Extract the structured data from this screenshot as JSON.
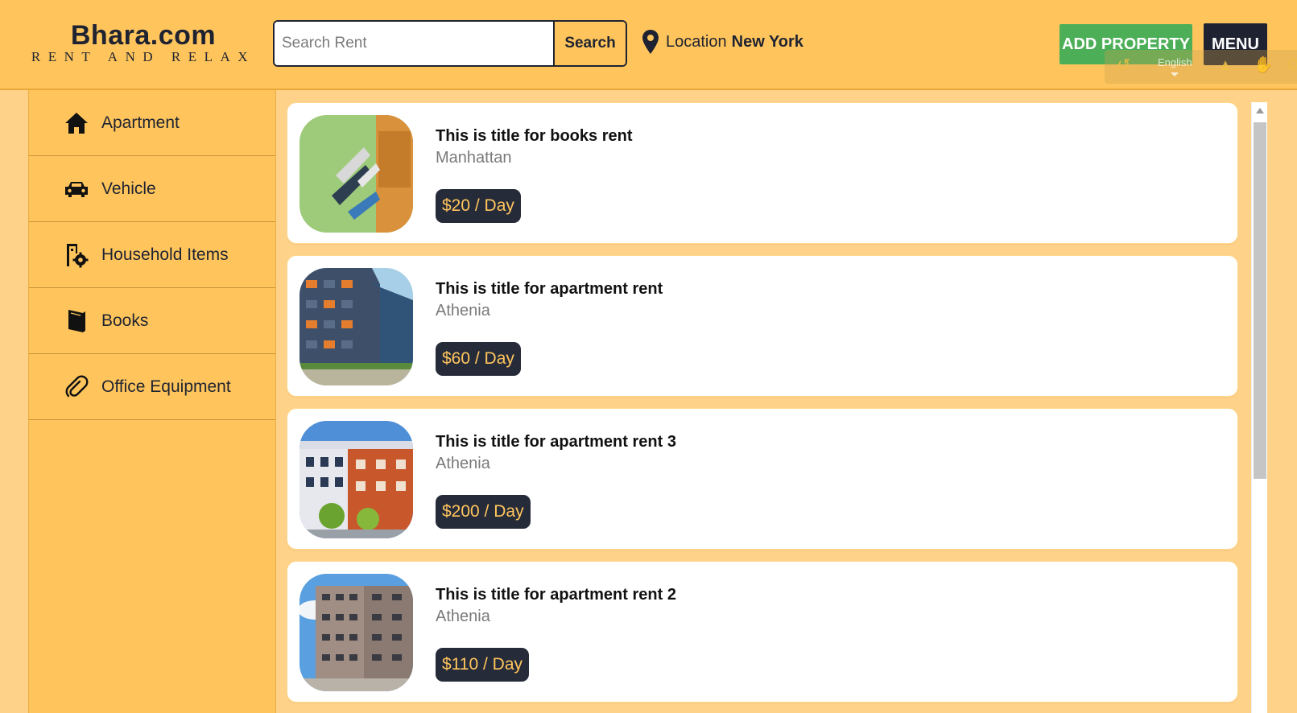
{
  "brand": {
    "title": "Bhara.com",
    "tagline": "RENT AND RELAX"
  },
  "search": {
    "placeholder": "Search Rent",
    "button_label": "Search"
  },
  "location": {
    "label": "Location",
    "value": "New York"
  },
  "header_buttons": {
    "add_property": "ADD PROPERTY",
    "menu": "MENU"
  },
  "toolbar": {
    "language": "English"
  },
  "sidebar": {
    "items": [
      {
        "label": "Apartment",
        "icon": "home-icon"
      },
      {
        "label": "Vehicle",
        "icon": "car-icon"
      },
      {
        "label": "Household Items",
        "icon": "household-gear-icon"
      },
      {
        "label": "Books",
        "icon": "book-icon"
      },
      {
        "label": "Office Equipment",
        "icon": "paperclip-icon"
      }
    ]
  },
  "listings": [
    {
      "title": "This is title for books rent",
      "location": "Manhattan",
      "price": "$20 / Day",
      "image": "books-shelf-image"
    },
    {
      "title": "This is title for apartment rent",
      "location": "Athenia",
      "price": "$60 / Day",
      "image": "apartment-building-image"
    },
    {
      "title": "This is title for apartment rent 3",
      "location": "Athenia",
      "price": "$200 / Day",
      "image": "apartment-building-image"
    },
    {
      "title": "This is title for apartment rent 2",
      "location": "Athenia",
      "price": "$110 / Day",
      "image": "apartment-building-image"
    }
  ],
  "colors": {
    "accent": "#ffc55c",
    "dark": "#1f2331",
    "add_button": "#4caf58",
    "price_bg": "#262b3a"
  }
}
